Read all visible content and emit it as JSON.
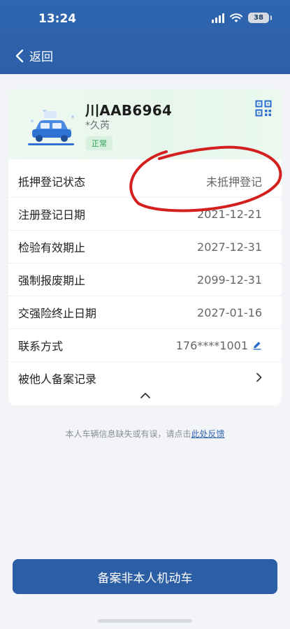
{
  "status_bar": {
    "time": "13:24",
    "battery": "38"
  },
  "nav": {
    "back_label": "返回"
  },
  "vehicle": {
    "plate": "川AAB6964",
    "owner": "*久芮",
    "status": "正常"
  },
  "details": [
    {
      "label": "抵押登记状态",
      "value": "未抵押登记"
    },
    {
      "label": "注册登记日期",
      "value": "2021-12-21"
    },
    {
      "label": "检验有效期止",
      "value": "2027-12-31"
    },
    {
      "label": "强制报废期止",
      "value": "2099-12-31"
    },
    {
      "label": "交强险终止日期",
      "value": "2027-01-16"
    },
    {
      "label": "联系方式",
      "value": "176****1001"
    },
    {
      "label": "被他人备案记录",
      "value": ""
    }
  ],
  "feedback": {
    "text": "本人车辆信息缺失或有误，请点击",
    "link": "此处反馈"
  },
  "cta_label": "备案非本人机动车",
  "colors": {
    "brand_blue": "#2c5ea6",
    "status_green": "#2f9d52",
    "annotation_red": "#d41f1f"
  }
}
